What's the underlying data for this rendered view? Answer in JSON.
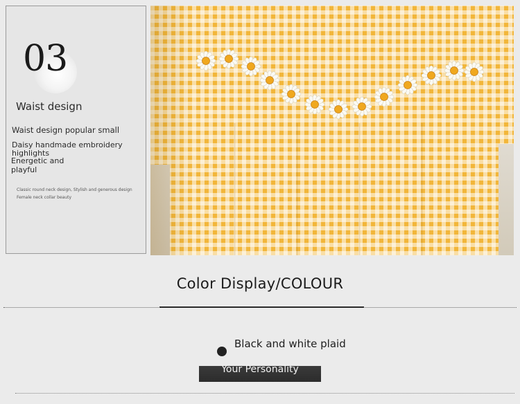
{
  "detail": {
    "number": "03",
    "title": "Waist design",
    "line1": "Waist design popular small",
    "line2": "Daisy handmade embroidery highlights",
    "line3": "Energetic and playful",
    "small1": "Classic round neck design,   Stylish and generous design",
    "small2": "Female neck collar beauty"
  },
  "photo": {
    "fabric_color": "#f2b63a",
    "subject": "yellow gingham dress with daisy lace waist trim"
  },
  "colors": {
    "section_title": "Color Display/COLOUR",
    "items": [
      {
        "name": "Black and white plaid",
        "swatch": "#222222"
      }
    ],
    "tag": "Your Personality"
  }
}
